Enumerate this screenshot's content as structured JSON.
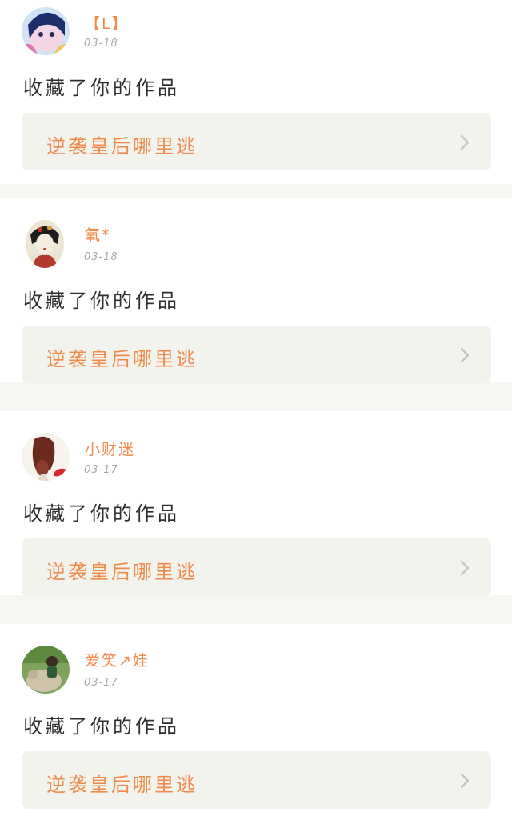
{
  "notifications": [
    {
      "user_name": "【L】",
      "date": "03-18",
      "action": "收藏了你的作品",
      "work_title": "逆袭皇后哪里逃",
      "avatar_icon": "anime-avatar-icon"
    },
    {
      "user_name": "氧*",
      "date": "03-18",
      "action": "收藏了你的作品",
      "work_title": "逆袭皇后哪里逃",
      "avatar_icon": "geisha-avatar-icon"
    },
    {
      "user_name": "小财迷",
      "date": "03-17",
      "action": "收藏了你的作品",
      "work_title": "逆袭皇后哪里逃",
      "avatar_icon": "girl-avatar-icon"
    },
    {
      "user_name": "爱笑↗娃",
      "date": "03-17",
      "action": "收藏了你的作品",
      "work_title": "逆袭皇后哪里逃",
      "avatar_icon": "photo-avatar-icon"
    }
  ],
  "colors": {
    "accent": "#f08a4b",
    "link_background": "#f3f3ee",
    "date": "#a9a9a9",
    "text": "#2e2e2e",
    "separator": "#f7f6f2"
  }
}
